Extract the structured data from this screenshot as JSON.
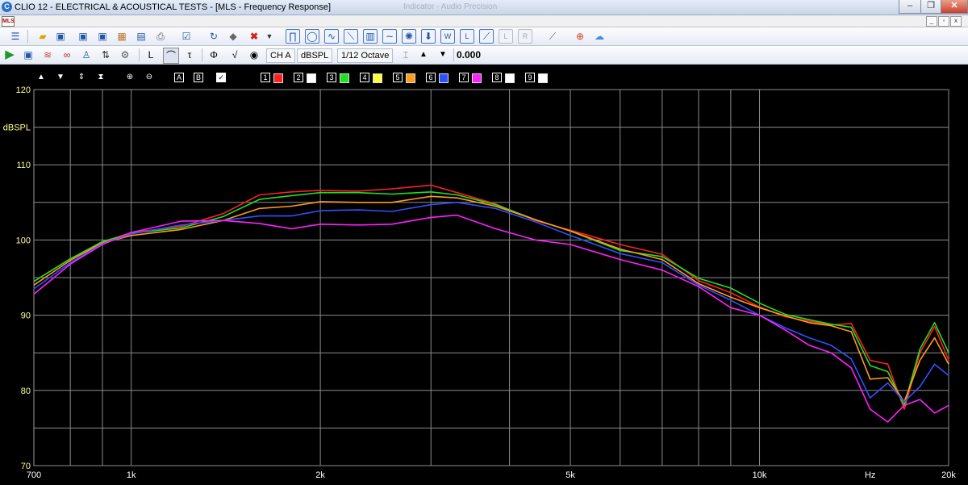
{
  "window": {
    "title": "CLIO 12 - ELECTRICAL & ACOUSTICAL TESTS - [MLS - Frequency Response]",
    "center_text": "Indicator - Audio Precision",
    "app_icon": "C",
    "doc_icon": "MLS"
  },
  "toolbar2": {
    "channel": "CH A",
    "units": "dBSPL",
    "smoothing": "1/12 Octave",
    "value": "0.000"
  },
  "plot_toolbar": {
    "marker_a": "A",
    "marker_b": "B",
    "curves": [
      {
        "num": "1",
        "color": "#ff2020"
      },
      {
        "num": "2",
        "color": "#ffffff"
      },
      {
        "num": "3",
        "color": "#20e020"
      },
      {
        "num": "4",
        "color": "#ffff40"
      },
      {
        "num": "5",
        "color": "#ff9a1a"
      },
      {
        "num": "6",
        "color": "#3050ff"
      },
      {
        "num": "7",
        "color": "#ff20ff"
      },
      {
        "num": "8",
        "color": "#ffffff"
      },
      {
        "num": "9",
        "color": "#ffffff"
      }
    ]
  },
  "chart_data": {
    "type": "line",
    "xlabel": "Hz",
    "ylabel": "dBSPL",
    "x_scale": "log",
    "xlim": [
      700,
      20000
    ],
    "ylim": [
      70,
      120
    ],
    "x_ticks": [
      "700",
      "1k",
      "2k",
      "5k",
      "10k",
      "Hz",
      "20k"
    ],
    "y_ticks": [
      "120",
      "110",
      "100",
      "90",
      "80",
      "70"
    ],
    "grid": true,
    "background": "#000000",
    "series": [
      {
        "color": "#ff2020",
        "x": [
          700,
          800,
          900,
          1000,
          1200,
          1400,
          1600,
          1800,
          2000,
          2300,
          2600,
          3000,
          3300,
          3800,
          4400,
          5000,
          6000,
          7000,
          8000,
          9000,
          10000,
          11000,
          12000,
          13000,
          14000,
          15000,
          16000,
          17000,
          18000,
          19000,
          20000
        ],
        "y": [
          94.5,
          97.5,
          99.7,
          101.0,
          101.8,
          103.5,
          106.0,
          106.4,
          106.6,
          106.5,
          106.8,
          107.3,
          106.3,
          104.8,
          102.6,
          101.3,
          99.4,
          98.1,
          94.6,
          93.0,
          91.1,
          89.8,
          89.2,
          88.7,
          88.9,
          84.0,
          83.5,
          77.5,
          85.0,
          88.5,
          84.0
        ]
      },
      {
        "color": "#20e020",
        "x": [
          700,
          800,
          900,
          1000,
          1200,
          1400,
          1600,
          1800,
          2000,
          2300,
          2600,
          3000,
          3300,
          3800,
          4400,
          5000,
          6000,
          7000,
          8000,
          9000,
          10000,
          11000,
          12000,
          13000,
          14000,
          15000,
          16000,
          17000,
          18000,
          19000,
          20000
        ],
        "y": [
          94.5,
          97.5,
          99.8,
          100.9,
          101.6,
          103.1,
          105.4,
          105.9,
          106.3,
          106.3,
          106.1,
          106.4,
          106.0,
          104.7,
          102.7,
          101.2,
          98.6,
          97.8,
          94.9,
          93.6,
          91.6,
          90.1,
          89.4,
          88.8,
          88.4,
          83.3,
          82.5,
          78.0,
          85.5,
          89.0,
          85.0
        ]
      },
      {
        "color": "#ff9a1a",
        "x": [
          700,
          800,
          900,
          1000,
          1200,
          1400,
          1600,
          1800,
          2000,
          2300,
          2600,
          3000,
          3300,
          3800,
          4400,
          5000,
          6000,
          7000,
          8000,
          9000,
          10000,
          11000,
          12000,
          13000,
          14000,
          15000,
          16000,
          17000,
          18000,
          19000,
          20000
        ],
        "y": [
          94.0,
          97.3,
          99.6,
          100.6,
          101.4,
          102.6,
          104.2,
          104.5,
          105.1,
          105.0,
          105.0,
          105.8,
          105.6,
          104.5,
          102.7,
          101.2,
          98.8,
          97.4,
          94.2,
          92.4,
          91.0,
          89.9,
          89.0,
          88.6,
          87.8,
          81.5,
          81.7,
          78.5,
          84.0,
          87.0,
          83.5
        ]
      },
      {
        "color": "#3050ff",
        "x": [
          700,
          800,
          900,
          1000,
          1200,
          1400,
          1600,
          1800,
          2000,
          2300,
          2600,
          3000,
          3300,
          3800,
          4400,
          5000,
          6000,
          7000,
          8000,
          9000,
          10000,
          11000,
          12000,
          13000,
          14000,
          15000,
          16000,
          17000,
          18000,
          19000,
          20000
        ],
        "y": [
          93.5,
          97.0,
          99.5,
          100.8,
          102.0,
          102.6,
          103.2,
          103.2,
          103.9,
          104.0,
          103.8,
          104.7,
          105.0,
          104.2,
          102.4,
          100.6,
          98.2,
          97.0,
          94.0,
          92.0,
          90.0,
          88.3,
          87.0,
          86.0,
          84.2,
          79.0,
          81.0,
          78.5,
          80.5,
          83.5,
          82.0
        ]
      },
      {
        "color": "#ff20ff",
        "x": [
          700,
          800,
          900,
          1000,
          1200,
          1400,
          1600,
          1800,
          2000,
          2300,
          2600,
          3000,
          3300,
          3800,
          4400,
          5000,
          6000,
          7000,
          8000,
          9000,
          10000,
          11000,
          12000,
          13000,
          14000,
          15000,
          16000,
          17000,
          18000,
          19000,
          20000
        ],
        "y": [
          92.8,
          96.8,
          99.4,
          101.0,
          102.5,
          102.6,
          102.2,
          101.5,
          102.1,
          102.0,
          102.1,
          103.0,
          103.3,
          101.5,
          100.0,
          99.4,
          97.4,
          96.0,
          93.8,
          91.0,
          90.0,
          88.0,
          86.0,
          85.0,
          83.0,
          77.5,
          75.8,
          78.0,
          78.8,
          77.0,
          78.0
        ]
      }
    ]
  }
}
